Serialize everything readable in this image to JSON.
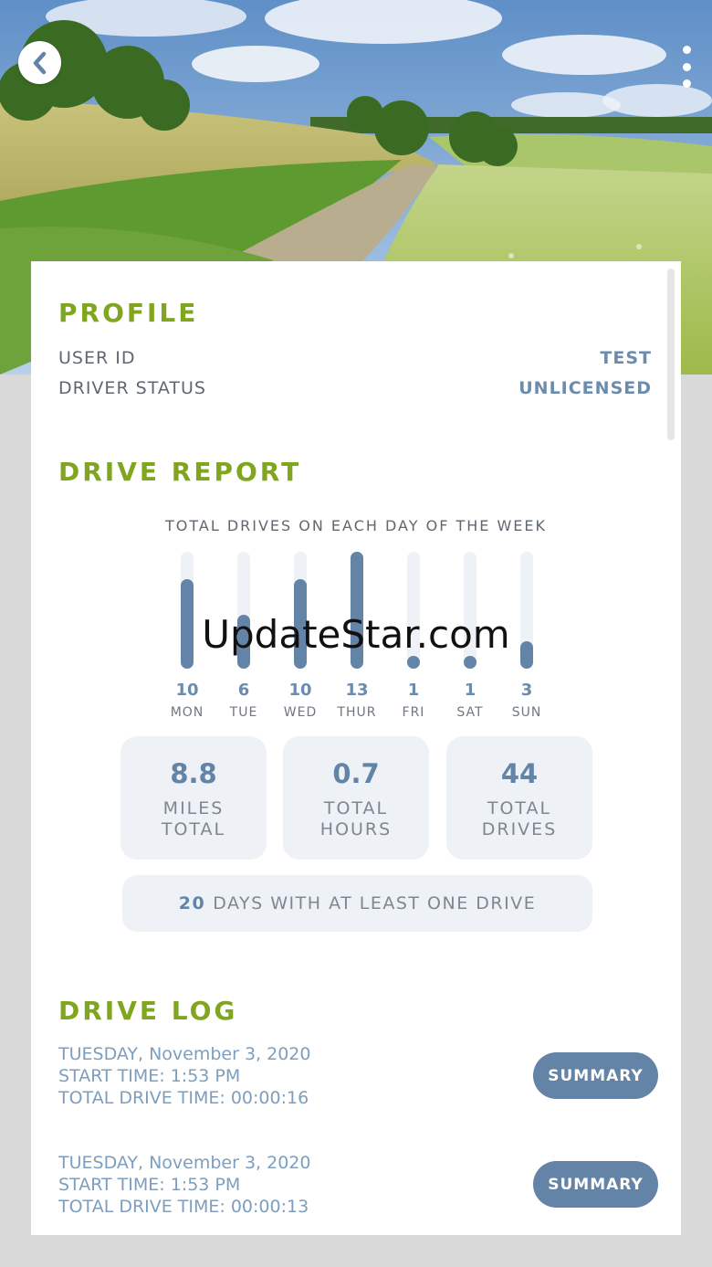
{
  "header": {
    "back_icon": "chevron-left-icon",
    "more_icon": "more-vertical-icon"
  },
  "profile": {
    "title": "PROFILE",
    "rows": [
      {
        "label": "USER ID",
        "value": "TEST"
      },
      {
        "label": "DRIVER STATUS",
        "value": "UNLICENSED"
      }
    ]
  },
  "drive_report": {
    "title": "DRIVE REPORT",
    "chart_caption": "TOTAL DRIVES ON EACH DAY OF THE WEEK",
    "stats": [
      {
        "value": "8.8",
        "label_line1": "MILES",
        "label_line2": "TOTAL"
      },
      {
        "value": "0.7",
        "label_line1": "TOTAL",
        "label_line2": "HOURS"
      },
      {
        "value": "44",
        "label_line1": "TOTAL",
        "label_line2": "DRIVES"
      }
    ],
    "days_count": "20",
    "days_text": "DAYS WITH AT LEAST ONE DRIVE"
  },
  "chart_data": {
    "type": "bar",
    "title": "TOTAL DRIVES ON EACH DAY OF THE WEEK",
    "categories": [
      "MON",
      "TUE",
      "WED",
      "THUR",
      "FRI",
      "SAT",
      "SUN"
    ],
    "values": [
      10,
      6,
      10,
      13,
      1,
      1,
      3
    ],
    "ylim": [
      0,
      13
    ],
    "color": "#6384a6",
    "track_color": "#eef2f6"
  },
  "drive_log": {
    "title": "DRIVE LOG",
    "entries": [
      {
        "date": "TUESDAY, November 3, 2020",
        "start": "START TIME: 1:53 PM",
        "duration": "TOTAL DRIVE TIME: 00:00:16",
        "button": "SUMMARY"
      },
      {
        "date": "TUESDAY, November 3, 2020",
        "start": "START TIME: 1:53 PM",
        "duration": "TOTAL DRIVE TIME: 00:00:13",
        "button": "SUMMARY"
      }
    ]
  },
  "watermark": "UpdateStar.com",
  "colors": {
    "accent_green": "#7fa61e",
    "accent_blue": "#6384a6",
    "tile_bg": "#eef2f6"
  }
}
